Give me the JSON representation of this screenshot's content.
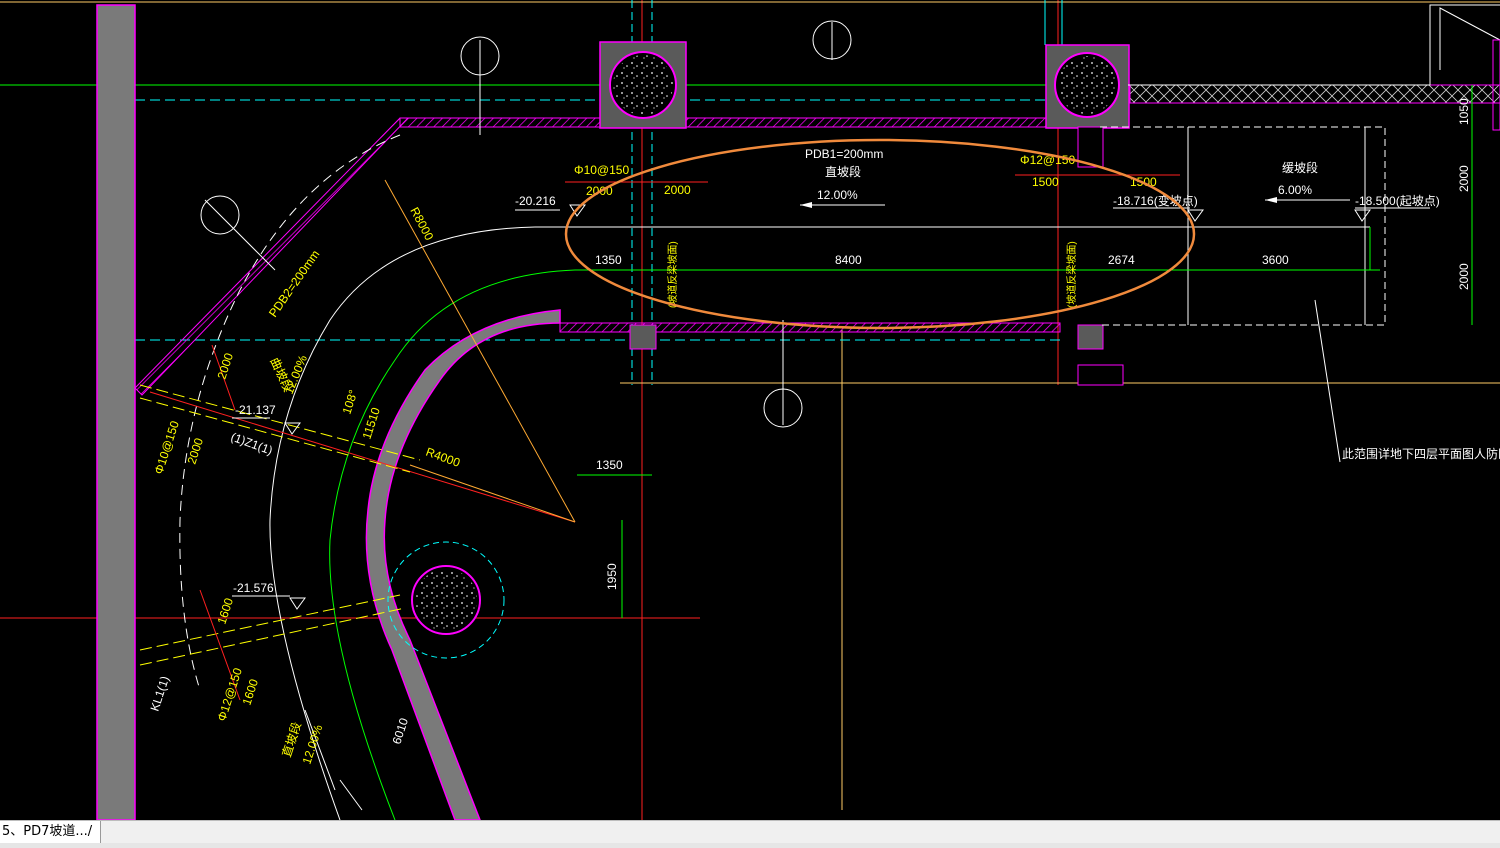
{
  "drawing": {
    "dims": {
      "d1350_top": "1350",
      "d8400": "8400",
      "d2674": "2674",
      "d3600": "3600",
      "d2000_a": "2000",
      "d2000_b": "2000",
      "d1500_a": "1500",
      "d1500_b": "1500",
      "d1350_mid": "1350",
      "d1950": "1950",
      "d2000_r1": "2000",
      "d2000_r2": "2000",
      "d1050": "1050",
      "d2000_diag1": "2000",
      "d2000_diag2": "2000",
      "d1600_a": "1600",
      "d1600_b": "1600",
      "d6010": "6010",
      "d11510": "11510",
      "d108": "108°"
    },
    "labels": {
      "slab1": "PDB1=200mm",
      "straight1": "直坡段",
      "slope12": "12.00%",
      "slope6": "6.00%",
      "gentle": "缓坡段",
      "rebar10": "Φ10@150",
      "rebar12": "Φ12@150",
      "elev1": "-20.216",
      "elev2": "-18.716(变坡点)",
      "elev3": "-18.500(起坡点)",
      "elev4": "-21.137",
      "elev5": "-21.576",
      "slab2": "PDB2=200mm",
      "slope_diag": "12.00%",
      "curve_label": "曲坡段",
      "r8000": "R8000",
      "r4000": "R4000",
      "kl1": "(1)Z1(1)",
      "kl2": "KL1(1)",
      "rebar_diag1": "Φ10@150",
      "rebar_diag2": "Φ12@150",
      "straight2": "直坡段",
      "slope_bottom": "12.00%",
      "note": "此范围详地下四层平面图人防区域构造做法",
      "vert1": "(坡道反梁坡面)",
      "vert2": "(坡道反梁坡面)"
    },
    "colors": {
      "highlight": "#f08a3c",
      "wall_fill": "#7a7a7a",
      "magenta": "#ff00ff",
      "cyan": "#00ffff",
      "red": "#ff2020",
      "green": "#00ff00",
      "yellow": "#ffff00"
    }
  },
  "tabbar": {
    "tab_label": "5、PD7坡道.../"
  }
}
